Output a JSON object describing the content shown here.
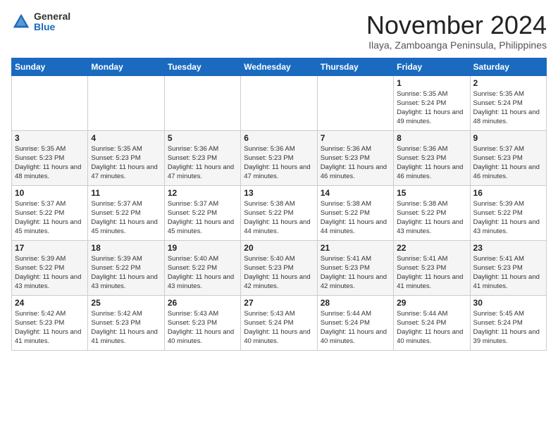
{
  "header": {
    "logo_general": "General",
    "logo_blue": "Blue",
    "month_title": "November 2024",
    "location": "Ilaya, Zamboanga Peninsula, Philippines"
  },
  "weekdays": [
    "Sunday",
    "Monday",
    "Tuesday",
    "Wednesday",
    "Thursday",
    "Friday",
    "Saturday"
  ],
  "weeks": [
    [
      {
        "day": "",
        "info": ""
      },
      {
        "day": "",
        "info": ""
      },
      {
        "day": "",
        "info": ""
      },
      {
        "day": "",
        "info": ""
      },
      {
        "day": "",
        "info": ""
      },
      {
        "day": "1",
        "info": "Sunrise: 5:35 AM\nSunset: 5:24 PM\nDaylight: 11 hours and 49 minutes."
      },
      {
        "day": "2",
        "info": "Sunrise: 5:35 AM\nSunset: 5:24 PM\nDaylight: 11 hours and 48 minutes."
      }
    ],
    [
      {
        "day": "3",
        "info": "Sunrise: 5:35 AM\nSunset: 5:23 PM\nDaylight: 11 hours and 48 minutes."
      },
      {
        "day": "4",
        "info": "Sunrise: 5:35 AM\nSunset: 5:23 PM\nDaylight: 11 hours and 47 minutes."
      },
      {
        "day": "5",
        "info": "Sunrise: 5:36 AM\nSunset: 5:23 PM\nDaylight: 11 hours and 47 minutes."
      },
      {
        "day": "6",
        "info": "Sunrise: 5:36 AM\nSunset: 5:23 PM\nDaylight: 11 hours and 47 minutes."
      },
      {
        "day": "7",
        "info": "Sunrise: 5:36 AM\nSunset: 5:23 PM\nDaylight: 11 hours and 46 minutes."
      },
      {
        "day": "8",
        "info": "Sunrise: 5:36 AM\nSunset: 5:23 PM\nDaylight: 11 hours and 46 minutes."
      },
      {
        "day": "9",
        "info": "Sunrise: 5:37 AM\nSunset: 5:23 PM\nDaylight: 11 hours and 46 minutes."
      }
    ],
    [
      {
        "day": "10",
        "info": "Sunrise: 5:37 AM\nSunset: 5:22 PM\nDaylight: 11 hours and 45 minutes."
      },
      {
        "day": "11",
        "info": "Sunrise: 5:37 AM\nSunset: 5:22 PM\nDaylight: 11 hours and 45 minutes."
      },
      {
        "day": "12",
        "info": "Sunrise: 5:37 AM\nSunset: 5:22 PM\nDaylight: 11 hours and 45 minutes."
      },
      {
        "day": "13",
        "info": "Sunrise: 5:38 AM\nSunset: 5:22 PM\nDaylight: 11 hours and 44 minutes."
      },
      {
        "day": "14",
        "info": "Sunrise: 5:38 AM\nSunset: 5:22 PM\nDaylight: 11 hours and 44 minutes."
      },
      {
        "day": "15",
        "info": "Sunrise: 5:38 AM\nSunset: 5:22 PM\nDaylight: 11 hours and 43 minutes."
      },
      {
        "day": "16",
        "info": "Sunrise: 5:39 AM\nSunset: 5:22 PM\nDaylight: 11 hours and 43 minutes."
      }
    ],
    [
      {
        "day": "17",
        "info": "Sunrise: 5:39 AM\nSunset: 5:22 PM\nDaylight: 11 hours and 43 minutes."
      },
      {
        "day": "18",
        "info": "Sunrise: 5:39 AM\nSunset: 5:22 PM\nDaylight: 11 hours and 43 minutes."
      },
      {
        "day": "19",
        "info": "Sunrise: 5:40 AM\nSunset: 5:22 PM\nDaylight: 11 hours and 43 minutes."
      },
      {
        "day": "20",
        "info": "Sunrise: 5:40 AM\nSunset: 5:23 PM\nDaylight: 11 hours and 42 minutes."
      },
      {
        "day": "21",
        "info": "Sunrise: 5:41 AM\nSunset: 5:23 PM\nDaylight: 11 hours and 42 minutes."
      },
      {
        "day": "22",
        "info": "Sunrise: 5:41 AM\nSunset: 5:23 PM\nDaylight: 11 hours and 41 minutes."
      },
      {
        "day": "23",
        "info": "Sunrise: 5:41 AM\nSunset: 5:23 PM\nDaylight: 11 hours and 41 minutes."
      }
    ],
    [
      {
        "day": "24",
        "info": "Sunrise: 5:42 AM\nSunset: 5:23 PM\nDaylight: 11 hours and 41 minutes."
      },
      {
        "day": "25",
        "info": "Sunrise: 5:42 AM\nSunset: 5:23 PM\nDaylight: 11 hours and 41 minutes."
      },
      {
        "day": "26",
        "info": "Sunrise: 5:43 AM\nSunset: 5:23 PM\nDaylight: 11 hours and 40 minutes."
      },
      {
        "day": "27",
        "info": "Sunrise: 5:43 AM\nSunset: 5:24 PM\nDaylight: 11 hours and 40 minutes."
      },
      {
        "day": "28",
        "info": "Sunrise: 5:44 AM\nSunset: 5:24 PM\nDaylight: 11 hours and 40 minutes."
      },
      {
        "day": "29",
        "info": "Sunrise: 5:44 AM\nSunset: 5:24 PM\nDaylight: 11 hours and 40 minutes."
      },
      {
        "day": "30",
        "info": "Sunrise: 5:45 AM\nSunset: 5:24 PM\nDaylight: 11 hours and 39 minutes."
      }
    ]
  ]
}
